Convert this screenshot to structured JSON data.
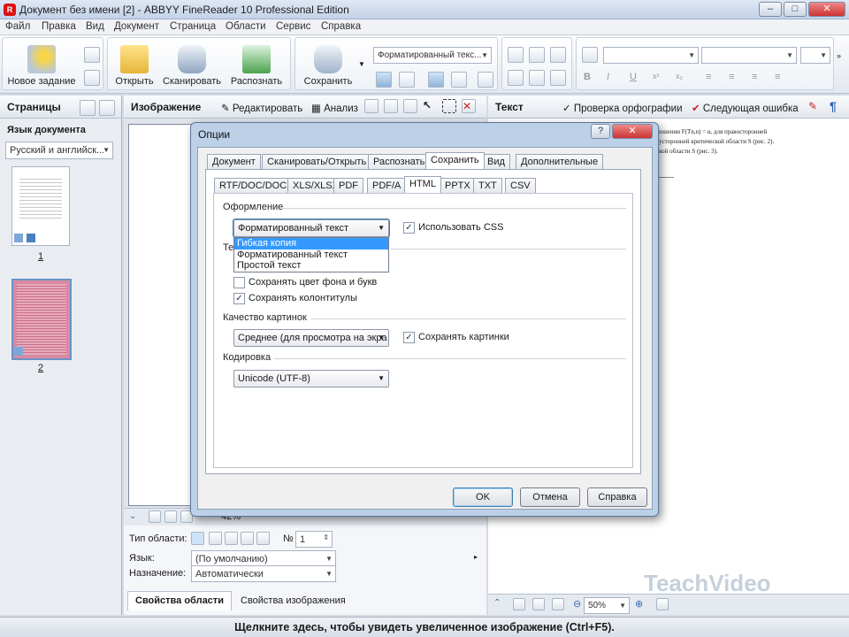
{
  "window": {
    "title": "Документ без имени [2] - ABBYY FineReader 10 Professional Edition"
  },
  "menu": [
    "Файл",
    "Правка",
    "Вид",
    "Документ",
    "Страница",
    "Области",
    "Сервис",
    "Справка"
  ],
  "toolbar": {
    "new_task": "Новое задание",
    "open": "Открыть",
    "scan": "Сканировать",
    "recognize": "Распознать",
    "save": "Сохранить",
    "format_combo": "Форматированный текс..."
  },
  "pages_panel": {
    "title": "Страницы",
    "lang_label": "Язык документа",
    "lang_value": "Русский и английск...",
    "page_numbers": [
      "1",
      "2"
    ]
  },
  "image_panel": {
    "title": "Изображение",
    "edit": "Редактировать",
    "analyze": "Анализ",
    "zoom": "42%",
    "area_type_label": "Тип области:",
    "number_label": "№",
    "number_value": "1",
    "lang_label": "Язык:",
    "lang_value": "(По умолчанию)",
    "purpose_label": "Назначение:",
    "purpose_value": "Автоматически",
    "tab_area_props": "Свойства области",
    "tab_image_props": "Свойства изображения"
  },
  "text_panel": {
    "title": "Текст",
    "spellcheck": "Проверка орфографии",
    "next_error": "Следующая ошибка",
    "zoom": "50%",
    "lines": [
      "ношении F(Tn,n) = α, для правосторонней",
      "вусторонней критической области S (рис. 2).",
      "ской области S (рис. 3)."
    ]
  },
  "dialog": {
    "title": "Опции",
    "help_glyph": "?",
    "close_glyph": "✕",
    "tabs": [
      "Документ",
      "Сканировать/Открыть",
      "Распознать",
      "Сохранить",
      "Вид",
      "Дополнительные"
    ],
    "active_tab": "Сохранить",
    "subtabs": [
      "RTF/DOC/DOCX",
      "XLS/XLSX",
      "PDF",
      "PDF/A",
      "HTML",
      "PPTX",
      "TXT",
      "CSV"
    ],
    "active_subtab": "HTML",
    "layout_group": "Оформление",
    "layout_value": "Форматированный текст",
    "use_css": "Использовать CSS",
    "dropdown_options": [
      "Гибкая копия",
      "Форматированный текст",
      "Простой текст"
    ],
    "dropdown_selected": "Гибкая копия",
    "text_group_partial": "Те",
    "keep_bg_color": "Сохранять цвет фона и букв",
    "keep_headers": "Сохранять колонтитулы",
    "pic_quality_group": "Качество картинок",
    "pic_quality_value": "Среднее (для просмотра на экра",
    "keep_pictures": "Сохранять картинки",
    "encoding_group": "Кодировка",
    "encoding_value": "Unicode (UTF-8)",
    "ok": "OK",
    "cancel": "Отмена",
    "help": "Справка"
  },
  "status": "Щелкните здесь, чтобы увидеть увеличенное изображение (Ctrl+F5).",
  "watermark": "TeachVideo"
}
